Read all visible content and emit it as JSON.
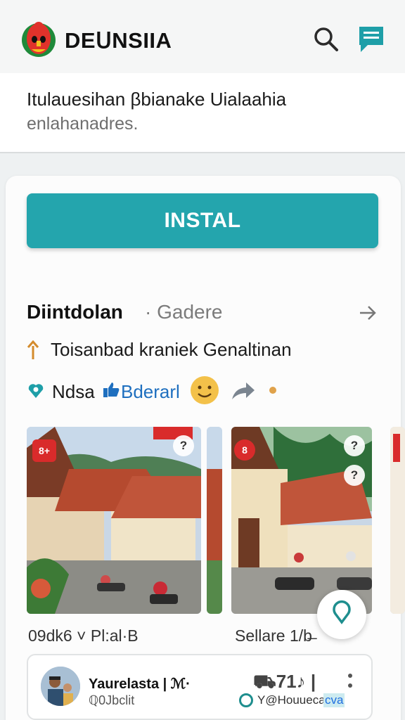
{
  "header": {
    "app_title": "DEᑌNSIIA",
    "logo_icon": "indonesian-mask-logo",
    "search_icon": "search-icon",
    "chat_icon": "chat-icon",
    "accent": "#1e9fa8"
  },
  "intro": {
    "line1": "Itulauesihan βbianake Uialaahia",
    "line2": "enlahanadres."
  },
  "install": {
    "label": "INSTAL",
    "color": "#24a5ad"
  },
  "section": {
    "title": "Diintdolan",
    "subtitle": "· Gadere",
    "more_icon": "arrow-right-icon"
  },
  "location": {
    "text": "Toisanbad kraniek Genaltinan"
  },
  "tags": {
    "tag1": "Ndsa",
    "tag2": "Bderarl",
    "emoji_icon": "smiling-face-icon",
    "share_icon": "share-arrow-icon"
  },
  "photos": {
    "badge1": "8+",
    "badge2": "8",
    "help": "?"
  },
  "meta": {
    "left": "09dk6 ˅  Pl:al·B",
    "right": "Sellare  1/b̶"
  },
  "user": {
    "name": "Yaurelasta | ℳ·",
    "sub": "ℚ0Jbclit",
    "stats": "⛟71♪ |",
    "status_text": "Y@Houuecal",
    "status_highlight": "cva"
  }
}
